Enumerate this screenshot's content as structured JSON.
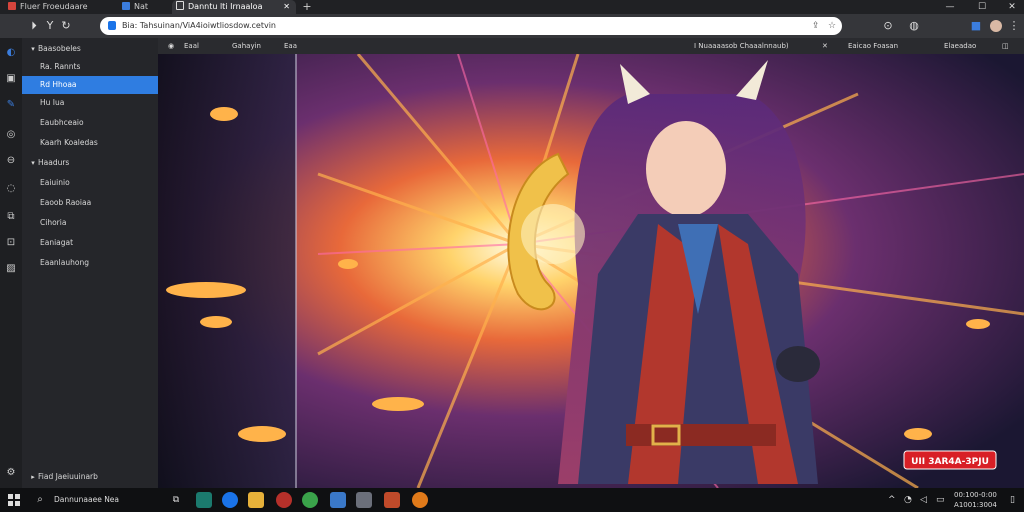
{
  "tabs": [
    {
      "label": "Fluer Froeudaare"
    },
    {
      "label": "Nat"
    },
    {
      "label": "Danntu lti Irnaaloa"
    }
  ],
  "window_controls": {
    "minimize": "—",
    "maximize": "☐",
    "close": "✕"
  },
  "address_bar": {
    "url": "Bia: Tahsuinan/ViA4ioiwtliosdow.cetvin"
  },
  "toolbar_icons": [
    "back-icon",
    "forward-icon",
    "reload-icon"
  ],
  "sidebar": {
    "items": [
      {
        "label": "Baasobeles",
        "level": 0,
        "expanded": true
      },
      {
        "label": "Ra. Rannts",
        "level": 1
      },
      {
        "label": "Rd Hhoaa",
        "level": 1,
        "selected": true
      },
      {
        "label": "Hu Iua",
        "level": 1
      },
      {
        "label": "Eaubhceaio",
        "level": 1
      },
      {
        "label": "Kaarh Koaledas",
        "level": 1
      },
      {
        "label": "Haadurs",
        "level": 0,
        "expanded": true
      },
      {
        "label": "Eaiuinio",
        "level": 1
      },
      {
        "label": "Eaoob Raoiaa",
        "level": 1
      },
      {
        "label": "Cihoria",
        "level": 1
      },
      {
        "label": "Eaniagat",
        "level": 1
      },
      {
        "label": "Eaanlauhong",
        "level": 1
      }
    ],
    "footer": "Fiad Jaeiuuinarb"
  },
  "subbar": {
    "left": [
      "Eaal",
      "Gahayin",
      "Eaa"
    ],
    "right": [
      "I Nuaaaasob Chaaalnnaub)",
      "Eaicao Foasan",
      "Elaeadao"
    ]
  },
  "artwork": {
    "badge_text": "UII 3AR4A-3PJU"
  },
  "taskbar": {
    "search_placeholder": "Dannunaaee Nea",
    "clock_time": "00:100-0:00",
    "clock_date": "A1001:3004"
  },
  "colors": {
    "accent": "#2f7de1",
    "badge": "#d81f26"
  }
}
